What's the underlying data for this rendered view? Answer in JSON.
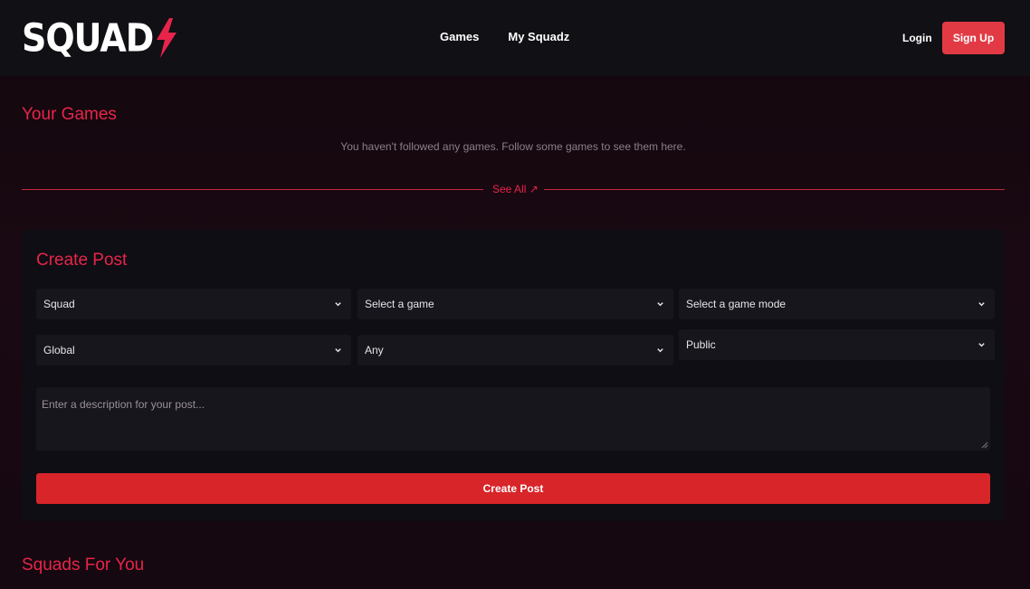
{
  "header": {
    "logo_text": "SQUAD",
    "nav": [
      {
        "label": "Games"
      },
      {
        "label": "My Squadz"
      }
    ],
    "login_label": "Login",
    "signup_label": "Sign Up"
  },
  "your_games": {
    "title": "Your Games",
    "empty_message": "You haven't followed any games. Follow some games to see them here.",
    "see_all_label": "See All ↗"
  },
  "create_post": {
    "title": "Create Post",
    "selects": {
      "type": "Squad",
      "game": "Select a game",
      "game_mode": "Select a game mode",
      "region": "Global",
      "skill": "Any",
      "visibility": "Public"
    },
    "description_placeholder": "Enter a description for your post...",
    "submit_label": "Create Post"
  },
  "squads_for_you": {
    "title": "Squads For You"
  },
  "colors": {
    "accent": "#e8244a",
    "button": "#d7252a",
    "header_bg": "#101015",
    "card_bg": "#0f0e14"
  }
}
